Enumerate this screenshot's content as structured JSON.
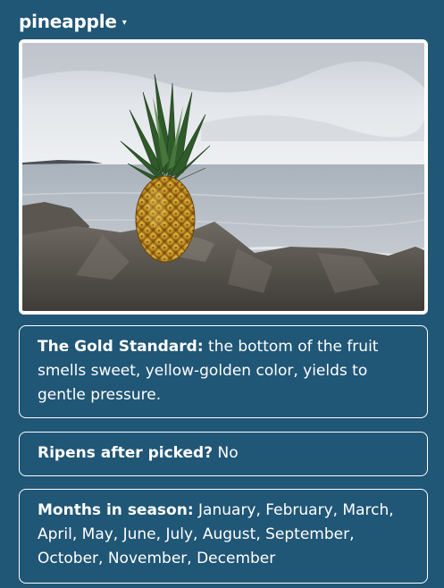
{
  "header": {
    "title": "pineapple",
    "caret": "▾"
  },
  "photo": {
    "subject": "pineapple-photo"
  },
  "cards": {
    "gold_standard": {
      "label": "The Gold Standard:",
      "text": " the bottom of the fruit smells sweet, yellow-golden color, yields to gentle pressure."
    },
    "ripens": {
      "label": "Ripens after picked?",
      "text": " No"
    },
    "months": {
      "label": "Months in season:",
      "text": " January, February, March, April, May, June, July, August, September, October, November, December"
    }
  },
  "colors": {
    "background": "#205676",
    "text": "#ffffff",
    "border": "#ffffff"
  }
}
